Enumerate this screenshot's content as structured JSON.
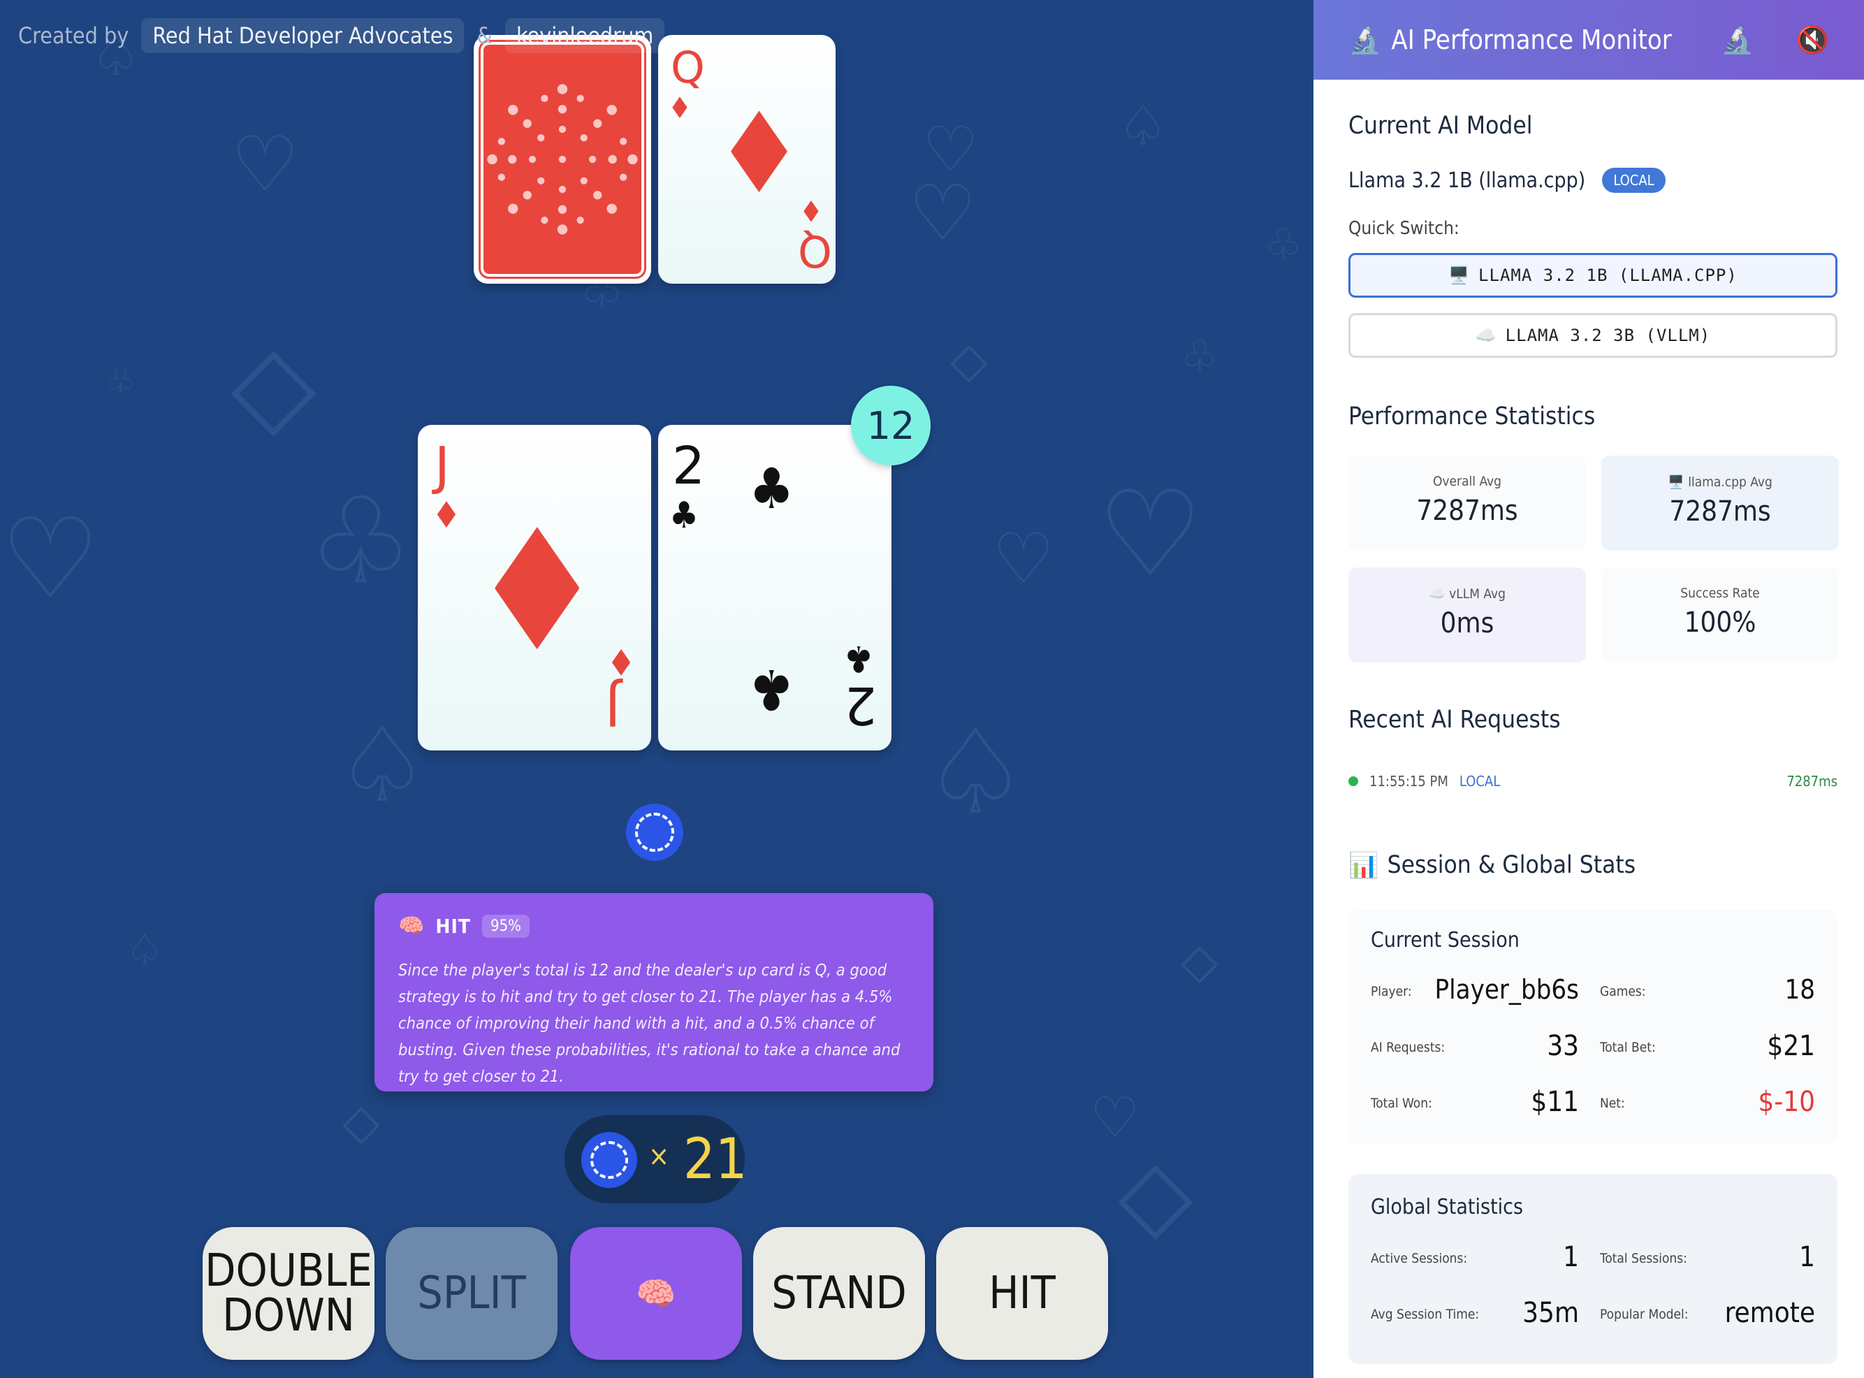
{
  "credits": {
    "prefix": "Created by",
    "author1": "Red Hat Developer Advocates",
    "separator": "&",
    "author2": "kevinleedrum"
  },
  "dealer": {
    "cards": [
      {
        "face_down": true
      },
      {
        "rank": "Q",
        "suit": "♦",
        "color": "#e8463c"
      }
    ]
  },
  "player": {
    "cards": [
      {
        "rank": "J",
        "suit": "♦",
        "color": "#e8463c"
      },
      {
        "rank": "2",
        "suit": "♣",
        "color": "#111111"
      }
    ],
    "score": "12"
  },
  "advice": {
    "icon": "🧠",
    "action": "HIT",
    "confidence": "95%",
    "text": "Since the player's total is 12 and the dealer's up card is Q, a good strategy is to hit and try to get closer to 21. The player has a 4.5% chance of improving their hand with a hit, and a 0.5% chance of busting. Given these probabilities, it's rational to take a chance and try to get closer to 21."
  },
  "chips": {
    "multiplier": "×",
    "count": "21"
  },
  "actions": {
    "double_down_line1": "DOUBLE",
    "double_down_line2": "DOWN",
    "split": "SPLIT",
    "ai": "🧠",
    "stand": "STAND",
    "hit": "HIT"
  },
  "panel": {
    "title": "AI Performance Monitor",
    "title_icon": "🔬",
    "header_icons": [
      "🔬",
      "🔇"
    ],
    "current_model_title": "Current AI Model",
    "current_model": "Llama 3.2 1B (llama.cpp)",
    "current_model_badge": "LOCAL",
    "quick_switch_label": "Quick Switch:",
    "quick_switch_options": [
      {
        "icon": "🖥️",
        "label": "LLAMA 3.2 1B (LLAMA.CPP)",
        "active": true
      },
      {
        "icon": "☁️",
        "label": "LLAMA 3.2 3B (VLLM)",
        "active": false
      }
    ],
    "perf_title": "Performance Statistics",
    "perf_stats": [
      {
        "label": "Overall Avg",
        "value": "7287ms"
      },
      {
        "label": "🖥️ llama.cpp Avg",
        "value": "7287ms"
      },
      {
        "label": "☁️ vLLM Avg",
        "value": "0ms"
      },
      {
        "label": "Success Rate",
        "value": "100%"
      }
    ],
    "recent_title": "Recent AI Requests",
    "recent_requests": [
      {
        "time": "11:55:15 PM",
        "source": "LOCAL",
        "duration": "7287ms"
      }
    ],
    "session_title_icon": "📊",
    "session_title": "Session & Global Stats",
    "current_session": {
      "title": "Current Session",
      "player_label": "Player:",
      "player": "Player_bb6s",
      "games_label": "Games:",
      "games": "18",
      "ai_requests_label": "AI Requests:",
      "ai_requests": "33",
      "total_bet_label": "Total Bet:",
      "total_bet": "$21",
      "total_won_label": "Total Won:",
      "total_won": "$11",
      "net_label": "Net:",
      "net": "$-10"
    },
    "global": {
      "title": "Global Statistics",
      "active_sessions_label": "Active Sessions:",
      "active_sessions": "1",
      "total_sessions_label": "Total Sessions:",
      "total_sessions": "1",
      "avg_session_label": "Avg Session Time:",
      "avg_session": "35m",
      "popular_model_label": "Popular Model:",
      "popular_model": "remote"
    }
  },
  "colors": {
    "table": "#1e4481",
    "card_red": "#e8463c",
    "advice": "#8f59ea",
    "score_badge": "#7ef2e2",
    "chip_yellow": "#f5d44a",
    "net_negative": "#e23b3b",
    "panel_header_start": "#6b77d8",
    "panel_header_end": "#7a5bd0"
  }
}
